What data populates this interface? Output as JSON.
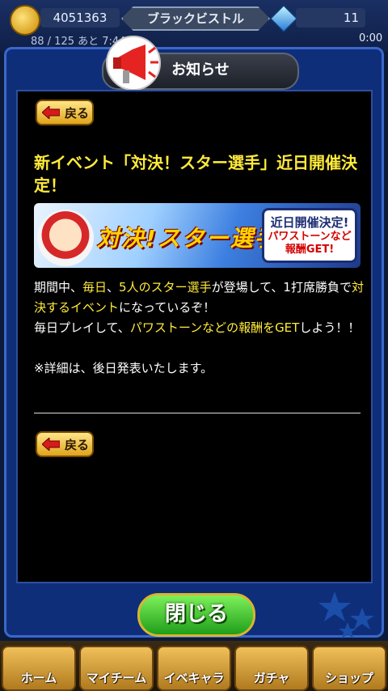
{
  "topbar": {
    "coins": "4051363",
    "deck_name": "ブラックビストル",
    "gems": "11",
    "stamina": "88 / 125 あと  7:44",
    "timer": "0:00"
  },
  "modal": {
    "header_title": "お知らせ",
    "back_label": "戻る",
    "title": "新イベント「対決！スター選手」近日開催決定！",
    "banner": {
      "logo": "対決!スター選手",
      "badge_line1": "近日開催決定!",
      "badge_line2": "パワストーンなど報酬GET!"
    },
    "body": {
      "p1_a": "期間中、",
      "p1_b": "毎日",
      "p1_c": "、",
      "p1_d": "5人のスター選手",
      "p1_e": "が登場して、1打席勝負で",
      "p1_f": "対決するイベント",
      "p1_g": "になっているぞ！",
      "p2_a": "毎日プレイして、",
      "p2_b": "パワストーンなどの報酬をGET",
      "p2_c": "しよう！！",
      "p3": "※詳細は、後日発表いたします。"
    },
    "close_label": "閉じる"
  },
  "bottomnav": {
    "items": [
      "ホーム",
      "マイチーム",
      "イベキャラ",
      "ガチャ",
      "ショップ"
    ]
  },
  "colors": {
    "accent_yellow": "#ffeb3b",
    "modal_blue": "#0f2e7a",
    "close_green": "#1f9e1b"
  }
}
